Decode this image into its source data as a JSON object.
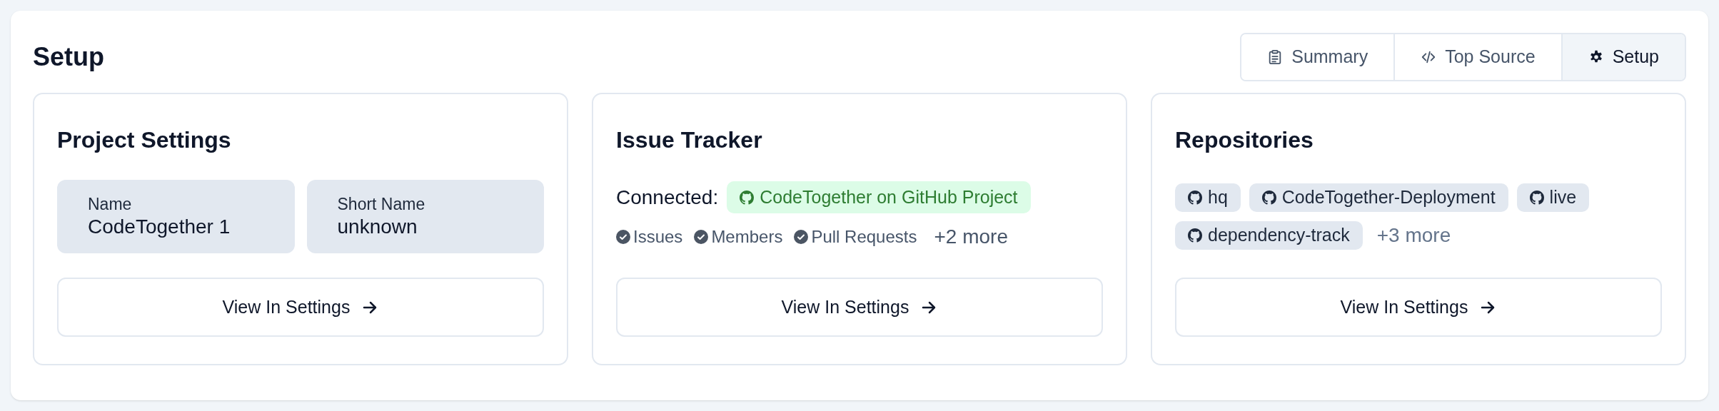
{
  "title": "Setup",
  "tabs": [
    {
      "label": "Summary",
      "kind": "clipboard",
      "selected": false
    },
    {
      "label": "Top Source",
      "kind": "code",
      "selected": false
    },
    {
      "label": "Setup",
      "kind": "gear",
      "selected": true
    }
  ],
  "cards": [
    {
      "kind": "fields",
      "title": "Project Settings",
      "fields": [
        {
          "label": "Name",
          "value": "CodeTogether 1"
        },
        {
          "label": "Short Name",
          "value": "unknown"
        }
      ],
      "button": "View In Settings"
    },
    {
      "kind": "tracker",
      "title": "Issue Tracker",
      "connected_label": "Connected:",
      "connection": "CodeTogether on GitHub Project",
      "features": [
        "Issues",
        "Members",
        "Pull Requests"
      ],
      "more": "+2 more",
      "button": "View In Settings"
    },
    {
      "kind": "repos",
      "title": "Repositories",
      "repos": [
        "hq",
        "CodeTogether-Deployment",
        "live",
        "dependency-track"
      ],
      "more": "+3 more",
      "button": "View In Settings"
    }
  ]
}
